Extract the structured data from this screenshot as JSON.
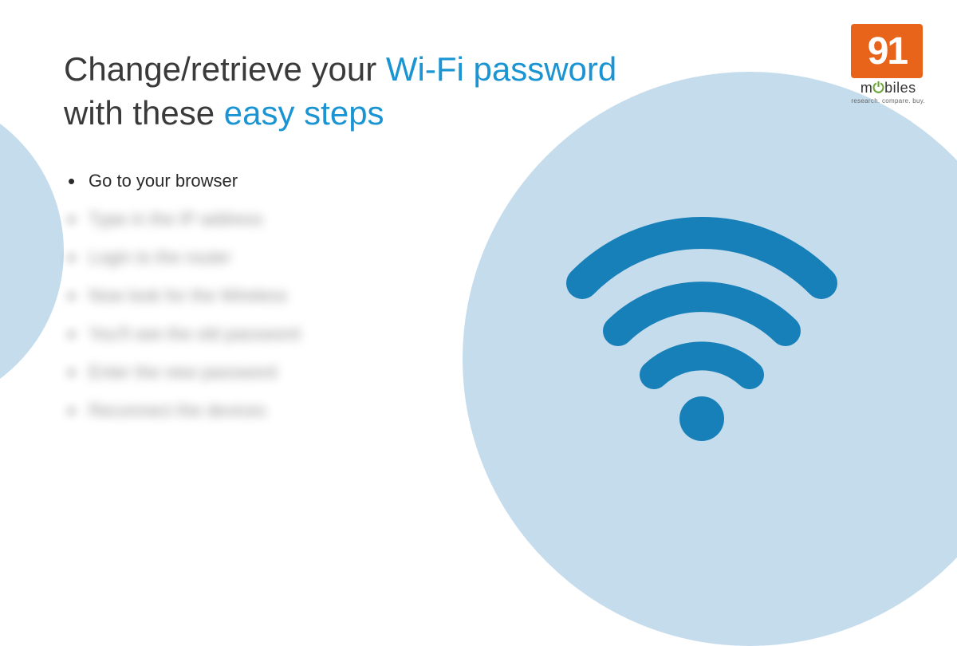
{
  "headline": {
    "part1": "Change/retrieve your ",
    "highlight1": "Wi-Fi password",
    "part2": " with these ",
    "highlight2": "easy steps"
  },
  "steps": [
    {
      "text": "Go to your browser",
      "blurred": false
    },
    {
      "text": "Type in the IP address",
      "blurred": true
    },
    {
      "text": "Login to the router",
      "blurred": true
    },
    {
      "text": "Now look for the Wireless",
      "blurred": true
    },
    {
      "text": "You'll see the old password",
      "blurred": true
    },
    {
      "text": "Enter the new password",
      "blurred": true
    },
    {
      "text": "Reconnect the devices",
      "blurred": true
    }
  ],
  "logo": {
    "number": "91",
    "brand_prefix": "m",
    "brand_o": "⏻",
    "brand_suffix": "biles",
    "tagline": "research. compare. buy."
  },
  "colors": {
    "accent_blue": "#1a94d2",
    "light_blue": "#c5dced",
    "wifi_blue": "#1880b8",
    "logo_orange": "#e8641b"
  }
}
